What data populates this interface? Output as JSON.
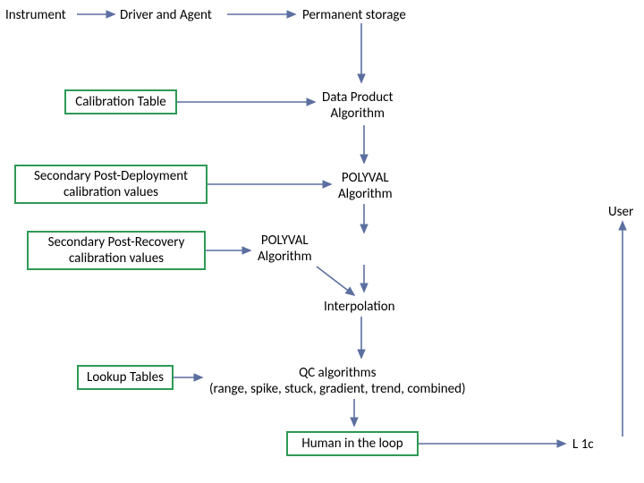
{
  "nodes": {
    "instrument": "Instrument",
    "driver_agent": "Driver and  Agent",
    "permanent_storage": "Permanent storage",
    "calibration_table": "Calibration Table",
    "data_product_algorithm": "Data Product\nAlgorithm",
    "secondary_post_deployment": "Secondary Post-Deployment\ncalibration values",
    "polyval_algorithm_1": "POLYVAL\nAlgorithm",
    "secondary_post_recovery": "Secondary Post-Recovery\ncalibration values",
    "polyval_algorithm_2": "POLYVAL\nAlgorithm",
    "interpolation": "Interpolation",
    "lookup_tables": "Lookup Tables",
    "qc_algorithms": "QC algorithms\n(range, spike, stuck, gradient, trend, combined)",
    "human_in_loop": "Human in the loop",
    "user": "User",
    "l1c": "L 1c"
  },
  "colors": {
    "box_border": "#2e9a54",
    "arrow": "#5b6fa0"
  }
}
